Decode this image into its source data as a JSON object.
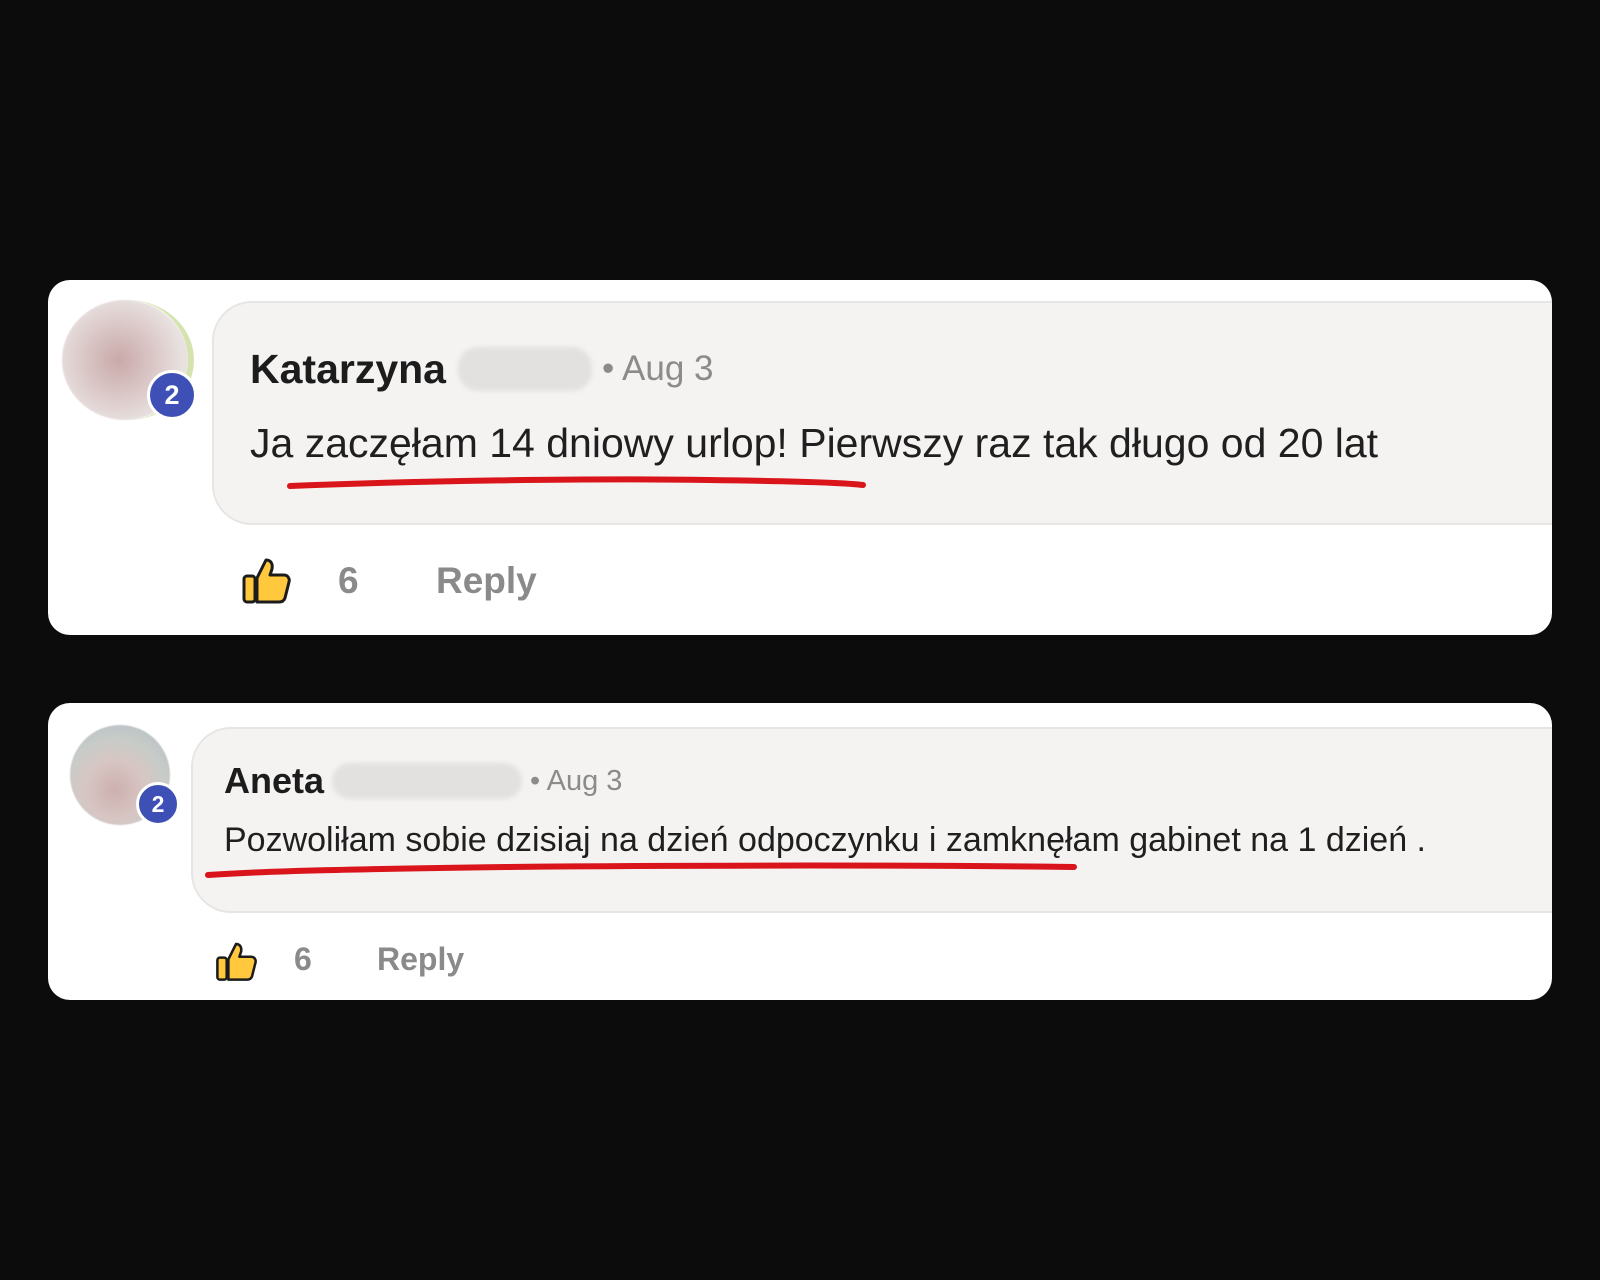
{
  "comments": [
    {
      "author": "Katarzyna",
      "time": "• Aug 3",
      "text": "Ja zaczęłam 14 dniowy urlop! Pierwszy raz tak długo od 20 lat",
      "badge": "2",
      "likes": "6",
      "reply_label": "Reply"
    },
    {
      "author": "Aneta",
      "time": "• Aug 3",
      "text": "Pozwoliłam sobie dzisiaj na dzień odpoczynku i zamknęłam gabinet na 1 dzień .",
      "badge": "2",
      "likes": "6",
      "reply_label": "Reply"
    }
  ],
  "colors": {
    "background": "#0c0c0c",
    "card": "#ffffff",
    "bubble": "#f4f3f2",
    "badge": "#3e50b5",
    "underline": "#d9141b",
    "meta_text": "#8a8a8a"
  },
  "icons": {
    "like": "thumbs-up-icon"
  }
}
